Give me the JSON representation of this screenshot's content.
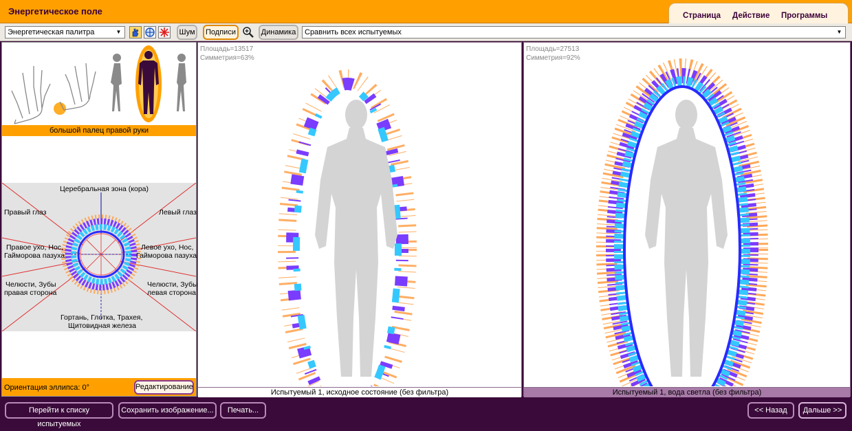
{
  "app": {
    "title": "Энергетическое поле"
  },
  "menu": {
    "items": [
      "Страница",
      "Действие",
      "Программы"
    ]
  },
  "toolbar": {
    "palette_select": "Энергетическая палитра",
    "noise_label": "Шум",
    "captions_label": "Подписи",
    "dynamics_label": "Динамика",
    "compare_select": "Сравнить всех испытуемых"
  },
  "left_panel": {
    "finger_caption": "большой палец правой руки",
    "zones": {
      "top": "Церебральная зона (кора)",
      "right_eye": "Правый глаз",
      "left_eye": "Левый глаз",
      "right_ear_1": "Правое ухо, Нос,",
      "right_ear_2": "Гайморова пазуха",
      "left_ear_1": "Левое ухо, Нос,",
      "left_ear_2": "Гайморова пазуха",
      "jaw_right_1": "Челюсти, Зубы",
      "jaw_right_2": "правая сторона",
      "jaw_left_1": "Челюсти, Зубы",
      "jaw_left_2": "левая сторона",
      "throat_1": "Гортань, Глотка, Трахея,",
      "throat_2": "Щитовидная железа"
    },
    "orientation_label": "Ориентация эллипса: 0°",
    "edit_button": "Редактирование"
  },
  "panels": [
    {
      "area": "Площадь=13517",
      "symmetry": "Симметрия=63%",
      "caption": "Испытуемый 1, исходное состояние (без фильтра)"
    },
    {
      "area": "Площадь=27513",
      "symmetry": "Симметрия=92%",
      "caption": "Испытуемый 1, вода светла (без фильтра)"
    }
  ],
  "bottom": {
    "to_list": "Перейти к списку испытуемых",
    "save_image": "Сохранить изображение...",
    "print": "Печать...",
    "back": "<< Назад",
    "next": "Дальше >>"
  },
  "colors": {
    "accent": "#ffa000",
    "frame": "#3a0b3a",
    "aura_outer": "#ff9a3c",
    "aura_mid": "#7a3cff",
    "aura_inner": "#35c8ff"
  },
  "icons": [
    "hand-icon",
    "compass-icon",
    "star-icon",
    "zoom-icon"
  ]
}
